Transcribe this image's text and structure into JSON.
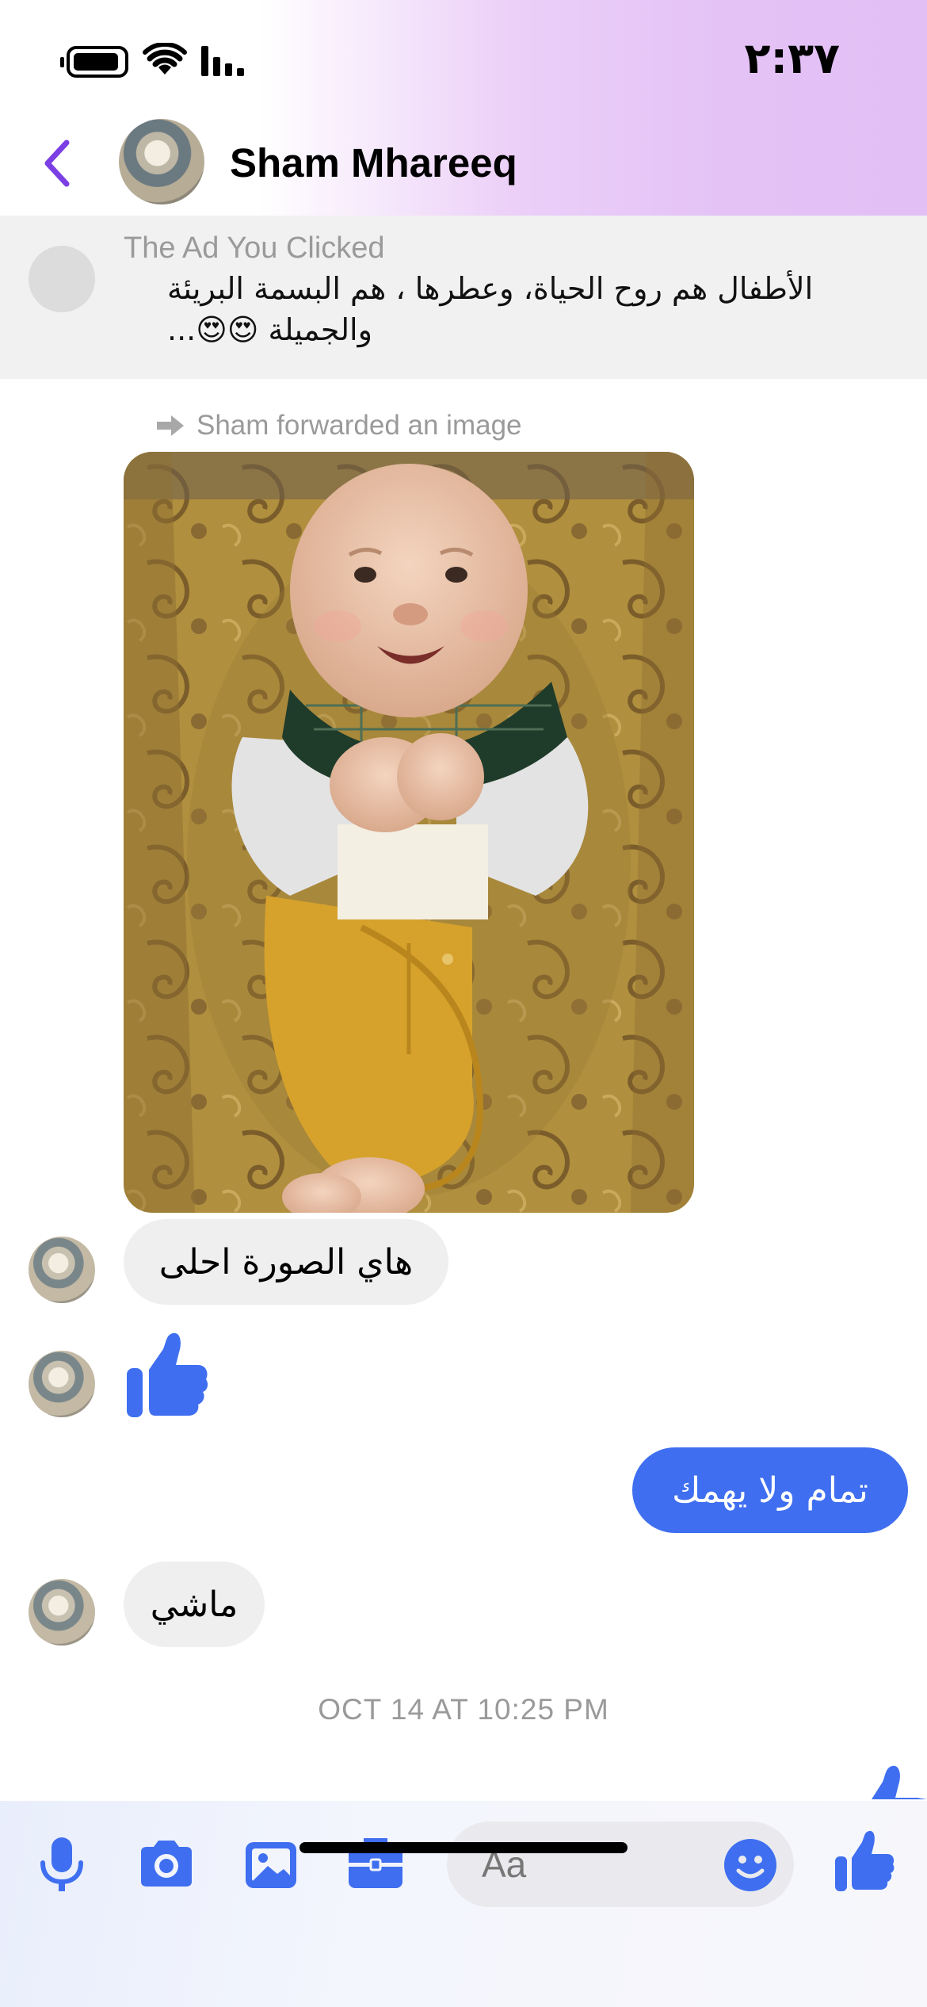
{
  "status_bar": {
    "time": "٢:٣٧"
  },
  "header": {
    "contact_name": "Sham Mhareeq"
  },
  "ad": {
    "title": "The Ad You Clicked",
    "text": "الأطفال هم روح الحياة، وعطرها ، هم البسمة البريئة والجميلة 😍😍..."
  },
  "thread": {
    "forward_note": "Sham forwarded an image",
    "messages": [
      {
        "from": "contact",
        "type": "image",
        "alt": ""
      },
      {
        "from": "contact",
        "type": "text",
        "text": "هاي الصورة احلى"
      },
      {
        "from": "contact",
        "type": "like"
      },
      {
        "from": "me",
        "type": "text",
        "text": "تمام ولا يهمك"
      },
      {
        "from": "contact",
        "type": "text",
        "text": "ماشي"
      }
    ],
    "timestamp": "OCT 14 AT 10:25 PM"
  },
  "composer": {
    "placeholder": "Aa",
    "tools": [
      "microphone-icon",
      "camera-icon",
      "photo-gallery-icon",
      "briefcase-icon"
    ]
  },
  "colors": {
    "accent": "#3f6ff0",
    "back_chevron": "#7b3fe4",
    "incoming_bubble": "#efefef",
    "header_gradient_end": "#e2c0f5"
  }
}
